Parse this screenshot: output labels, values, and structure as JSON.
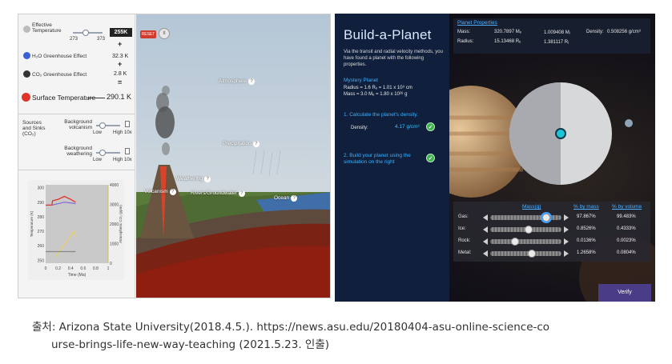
{
  "climate_sim": {
    "effective_temperature": {
      "label": "Effective Temperature",
      "slider_min": "273",
      "slider_max": "373",
      "value": "255K"
    },
    "h2o_effect": {
      "label": "H₂O Greenhouse Effect",
      "value": "32.3 K"
    },
    "co2_effect": {
      "label": "CO₂ Greenhouse Effect",
      "value": "2.8 K"
    },
    "plus": "+",
    "equals": "=",
    "surface_temperature": {
      "label": "Surface Temperature",
      "value": "290.1 K"
    },
    "sources_sinks": "Sources and Sinks (CO₂)",
    "background_volcanism": "Background volcanism",
    "background_weathering": "Background weathering",
    "low": "Low",
    "high": "High",
    "ten_x": "10x",
    "reset": "RESET",
    "pause": "II",
    "scene_labels": {
      "atmosphere": "Atmosphere",
      "precipitation": "Precipitation",
      "weathering": "Weathering",
      "volcanism": "Volcanism",
      "rivers": "Rivers/Groundwater",
      "ocean": "Ocean"
    },
    "question_glyph": "?",
    "colors": {
      "surface_dot": "#e0342a",
      "h2o_dot": "#3b5fd6",
      "co2_dot": "#333333"
    }
  },
  "chart_data": {
    "type": "line",
    "xlabel": "Time (Ma)",
    "ylabel": "Temperature (K)",
    "y2label": "Atmospheric CO₂ (ppm)",
    "x_ticks": [
      "0",
      "0.2",
      "0.4",
      "0.6",
      "0.8",
      "1"
    ],
    "y_ticks": [
      "250",
      "260",
      "270",
      "280",
      "290",
      "300"
    ],
    "y2_ticks": [
      "0",
      "1000",
      "2000",
      "3000",
      "4000"
    ],
    "xlim": [
      0,
      1
    ],
    "ylim": [
      248,
      302
    ],
    "series": [
      {
        "color": "#e0342a",
        "x": [
          0,
          0.1,
          0.11,
          0.2,
          0.3,
          0.4,
          0.48
        ],
        "y": [
          288,
          288,
          291,
          292,
          294,
          292,
          290
        ]
      },
      {
        "color": "#8a6fd6",
        "x": [
          0.1,
          0.2,
          0.3,
          0.4,
          0.48
        ],
        "y": [
          288,
          289,
          290,
          289.5,
          289
        ]
      },
      {
        "color": "#e8d070",
        "x": [
          0.15,
          0.25,
          0.35,
          0.45,
          0.48
        ],
        "y": [
          252,
          258,
          264,
          270,
          266
        ]
      },
      {
        "color": "#888888",
        "x": [
          0,
          0.48
        ],
        "y": [
          256,
          256
        ]
      }
    ]
  },
  "build_planet": {
    "title": "Build-a-Planet",
    "intro": "Via the transit and radial velocity methods, you have found a planet with the following properties.",
    "mystery_title": "Mystery Planet",
    "mystery_radius": "Radius = 1.6 Rₑ = 1.01 x 10⁹ cm",
    "mystery_mass": "Mass = 3.0 Mₑ = 1.80 x 10²⁸ g",
    "step1": "1. Calculate the planet's density.",
    "density_label": "Density:",
    "density_value": "4.17 g/cm³",
    "step2": "2. Build your planet using the simulation on the right",
    "check": "✓",
    "properties": {
      "title": "Planet Properties",
      "mass_label": "Mass:",
      "mass_earth": "320.7897 Mₑ",
      "mass_jup": "1.009408 Mⱼ",
      "radius_label": "Radius:",
      "radius_earth": "15.13468 Rₑ",
      "radius_jup": "1.381117 Rⱼ",
      "density_label": "Density:",
      "density_value": "0.508256 g/cm³"
    },
    "composition": {
      "headers": [
        "Mass(g)",
        "% by mass",
        "% by volume"
      ],
      "rows": [
        {
          "name": "Gas:",
          "pct_mass": "97.867%",
          "pct_vol": "99.483%",
          "level": 0.82
        },
        {
          "name": "Ice:",
          "pct_mass": "0.8526%",
          "pct_vol": "0.4333%",
          "level": 0.55
        },
        {
          "name": "Rock:",
          "pct_mass": "0.0136%",
          "pct_vol": "0.0023%",
          "level": 0.33
        },
        {
          "name": "Metal:",
          "pct_mass": "1.2658%",
          "pct_vol": "0.0804%",
          "level": 0.6
        }
      ]
    },
    "verify": "Verify"
  },
  "caption": {
    "line1": "출처: Arizona State University(2018.4.5.). https://news.asu.edu/20180404-asu-online-science-co",
    "line2": "urse-brings-life-new-way-teaching (2021.5.23. 인출)"
  }
}
